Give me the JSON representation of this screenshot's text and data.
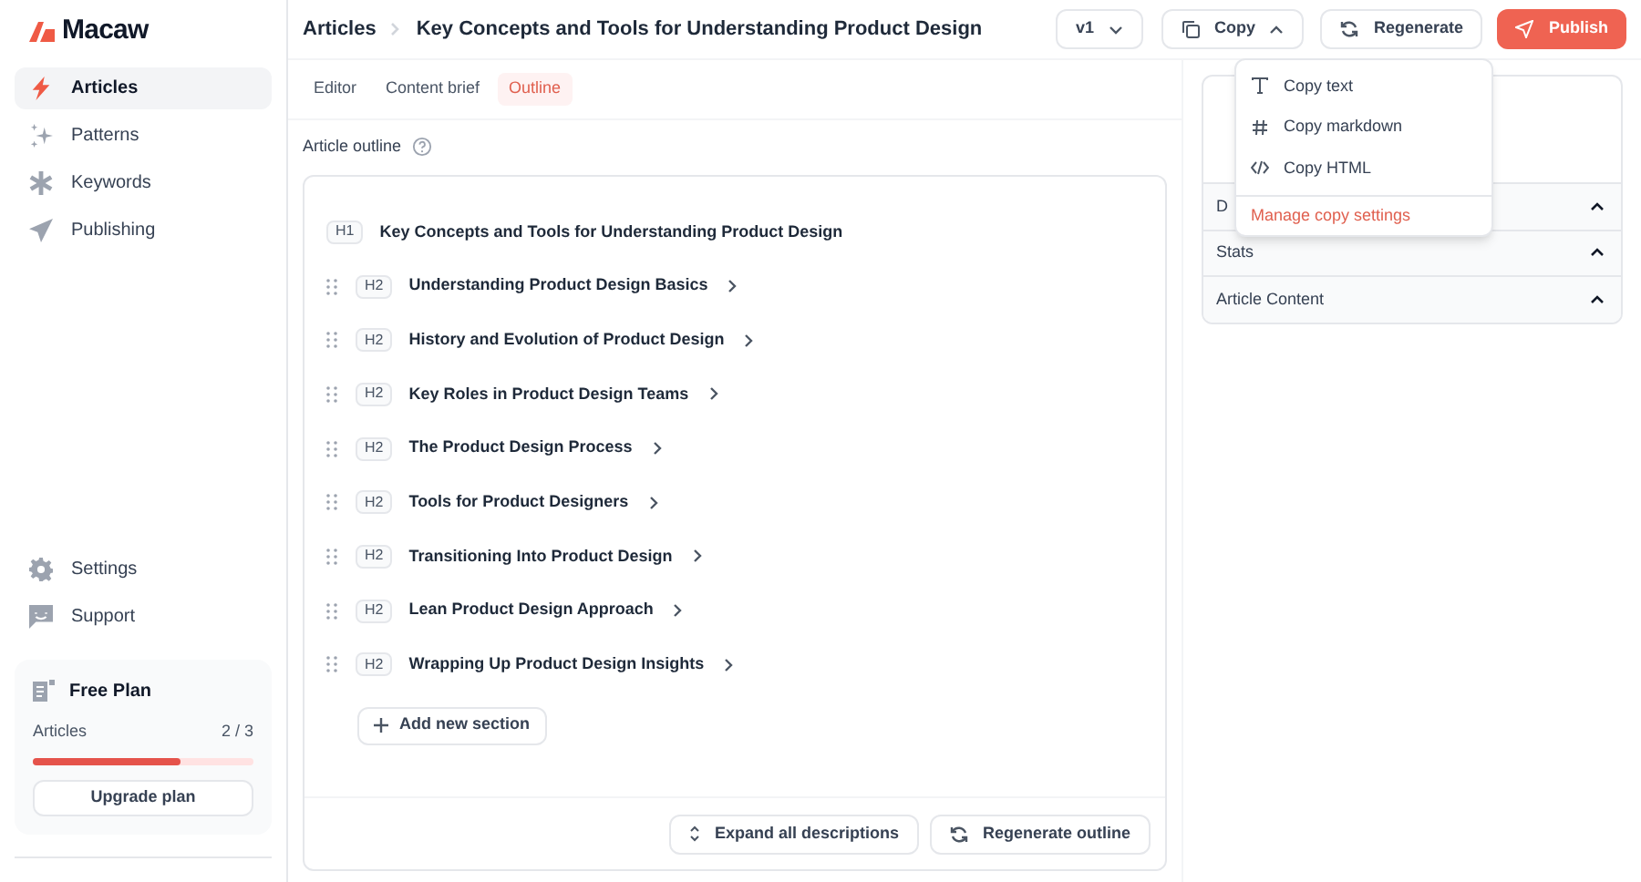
{
  "brand": "Macaw",
  "sidebar": {
    "items": [
      {
        "label": "Articles",
        "selected": true
      },
      {
        "label": "Patterns",
        "selected": false
      },
      {
        "label": "Keywords",
        "selected": false
      },
      {
        "label": "Publishing",
        "selected": false
      }
    ],
    "bottom_items": [
      {
        "label": "Settings"
      },
      {
        "label": "Support"
      }
    ],
    "plan": {
      "title": "Free Plan",
      "label": "Articles",
      "count": "2 / 3",
      "level": 0.67,
      "button": "Upgrade plan"
    }
  },
  "breadcrumb": [
    "Articles",
    "Key Concepts and Tools for Understanding Product Design"
  ],
  "toolbar": {
    "version": "v1",
    "copy": "Copy",
    "regenerate": "Regenerate",
    "publish": "Publish"
  },
  "tabs": [
    {
      "label": "Editor",
      "selected": false
    },
    {
      "label": "Content brief",
      "selected": false
    },
    {
      "label": "Outline",
      "selected": true
    }
  ],
  "outline": {
    "title": "Article outline",
    "items": [
      {
        "level": "H1",
        "text": "Key Concepts and Tools for Understanding Product Design"
      },
      {
        "level": "H2",
        "text": "Understanding Product Design Basics"
      },
      {
        "level": "H2",
        "text": "History and Evolution of Product Design"
      },
      {
        "level": "H2",
        "text": "Key Roles in Product Design Teams"
      },
      {
        "level": "H2",
        "text": "The Product Design Process"
      },
      {
        "level": "H2",
        "text": "Tools for Product Designers"
      },
      {
        "level": "H2",
        "text": "Transitioning Into Product Design"
      },
      {
        "level": "H2",
        "text": "Lean Product Design Approach"
      },
      {
        "level": "H2",
        "text": "Wrapping Up Product Design Insights"
      }
    ],
    "add_button": "Add new section",
    "expand_button": "Expand all descriptions",
    "regenerate_button": "Regenerate outline"
  },
  "panel": {
    "sections": [
      {
        "label": "D",
        "expanded": true
      },
      {
        "label": "Stats",
        "expanded": true
      },
      {
        "label": "Article Content",
        "expanded": true
      }
    ]
  },
  "copy_menu": {
    "items": [
      {
        "label": "Copy text"
      },
      {
        "label": "Copy markdown"
      },
      {
        "label": "Copy HTML"
      }
    ],
    "footer": "Manage copy settings"
  }
}
